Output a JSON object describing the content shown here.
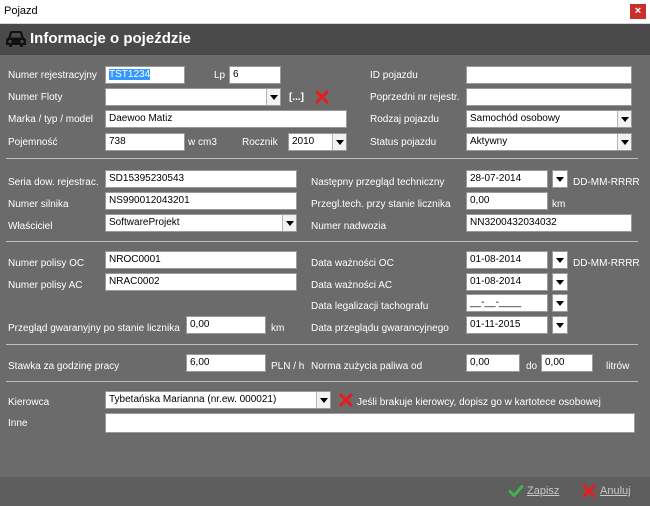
{
  "window": {
    "title": "Pojazd",
    "close_label": "×"
  },
  "header": {
    "title": "Informacje o pojeździe",
    "icon": "car-icon"
  },
  "vehicle": {
    "reg_label": "Numer rejestracyjny",
    "reg_value": "TST1234",
    "lp_label": "Lp",
    "lp_value": "6",
    "fleet_label": "Numer Floty",
    "fleet_value": "",
    "fleet_browse": "[...]",
    "make_label": "Marka / typ / model",
    "make_value": "Daewoo Matiz",
    "capacity_label": "Pojemność",
    "capacity_value": "738",
    "capacity_unit": "w cm3",
    "year_label": "Rocznik",
    "year_value": "2010",
    "id_label": "ID pojazdu",
    "id_value": "",
    "prev_reg_label": "Poprzedni nr rejestr.",
    "prev_reg_value": "",
    "type_label": "Rodzaj pojazdu",
    "type_value": "Samochód osobowy",
    "status_label": "Status pojazdu",
    "status_value": "Aktywny"
  },
  "docs": {
    "series_label": "Seria dow. rejestrac.",
    "series_value": "SD15395230543",
    "engine_label": "Numer silnika",
    "engine_value": "NS990012043201",
    "owner_label": "Właściciel",
    "owner_value": "SoftwareProjekt",
    "next_insp_label": "Następny przegląd techniczny",
    "next_insp_value": "28-07-2014",
    "date_format": "DD-MM-RRRR",
    "insp_mileage_label": "Przegl.tech. przy stanie licznika",
    "insp_mileage_value": "0,00",
    "km_unit": "km",
    "vin_label": "Numer nadwozia",
    "vin_value": "NN3200432034032"
  },
  "insurance": {
    "oc_label": "Numer polisy OC",
    "oc_value": "NROC0001",
    "ac_label": "Numer polisy AC",
    "ac_value": "NRAC0002",
    "oc_date_label": "Data ważności OC",
    "oc_date_value": "01-08-2014",
    "date_format": "DD-MM-RRRR",
    "ac_date_label": "Data ważności AC",
    "ac_date_value": "01-08-2014",
    "tacho_label": "Data legalizacji tachografu",
    "tacho_value": "__-__-____",
    "warranty_date_label": "Data przeglądu gwarancyjnego",
    "warranty_date_value": "01-11-2015",
    "warranty_mileage_label": "Przegląd gwaranyjny po stanie licznika",
    "warranty_mileage_value": "0,00",
    "km_unit": "km"
  },
  "costs": {
    "rate_label": "Stawka za godzinę pracy",
    "rate_value": "6,00",
    "rate_unit": "PLN / h",
    "fuel_label": "Norma zużycia paliwa od",
    "fuel_from": "0,00",
    "fuel_to_label": "do",
    "fuel_to": "0,00",
    "fuel_unit": "litrów"
  },
  "driver": {
    "label": "Kierowca",
    "value": "Tybetańska Marianna (nr.ew. 000021)",
    "hint": "Jeśli brakuje kierowcy, dopisz go w kartotece osobowej",
    "other_label": "Inne",
    "other_value": ""
  },
  "footer": {
    "save_label": "Zapisz",
    "cancel_label": "Anuluj"
  },
  "colors": {
    "background": "#6b6b6b",
    "header": "#4a4a4a",
    "selection": "#3399ff",
    "cancel_red": "#e02020",
    "save_green": "#3fb34f"
  }
}
